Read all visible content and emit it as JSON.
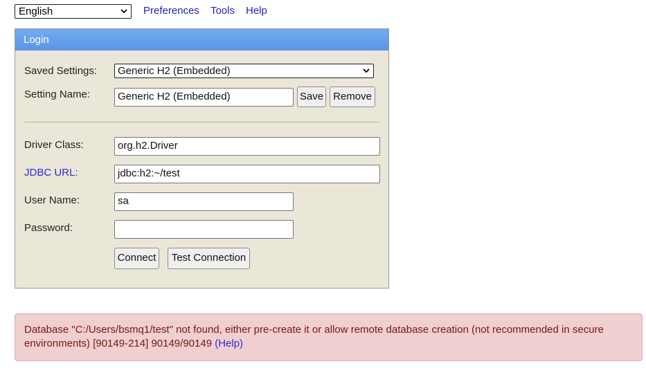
{
  "top_bar": {
    "language": "English",
    "links": {
      "preferences": "Preferences",
      "tools": "Tools",
      "help": "Help"
    }
  },
  "login": {
    "title": "Login",
    "saved_settings": {
      "label": "Saved Settings:",
      "value": "Generic H2 (Embedded)"
    },
    "setting_name": {
      "label": "Setting Name:",
      "value": "Generic H2 (Embedded)"
    },
    "save_label": "Save",
    "remove_label": "Remove",
    "driver_class": {
      "label": "Driver Class:",
      "value": "org.h2.Driver"
    },
    "jdbc_url": {
      "label": "JDBC URL:",
      "value": "jdbc:h2:~/test"
    },
    "user_name": {
      "label": "User Name:",
      "value": "sa"
    },
    "password": {
      "label": "Password:",
      "value": ""
    },
    "connect_label": "Connect",
    "test_connection_label": "Test Connection"
  },
  "error": {
    "message": "Database \"C:/Users/bsmq1/test\" not found, either pre-create it or allow remote database creation (not recommended in secure environments) [90149-214] 90149/90149",
    "help_link": "(Help)"
  },
  "colors": {
    "header_blue": "#5a95e8",
    "panel_bg": "#ebe7d8",
    "error_bg": "#efcfd0",
    "error_text": "#7a1515",
    "link": "#2b2bd6"
  }
}
